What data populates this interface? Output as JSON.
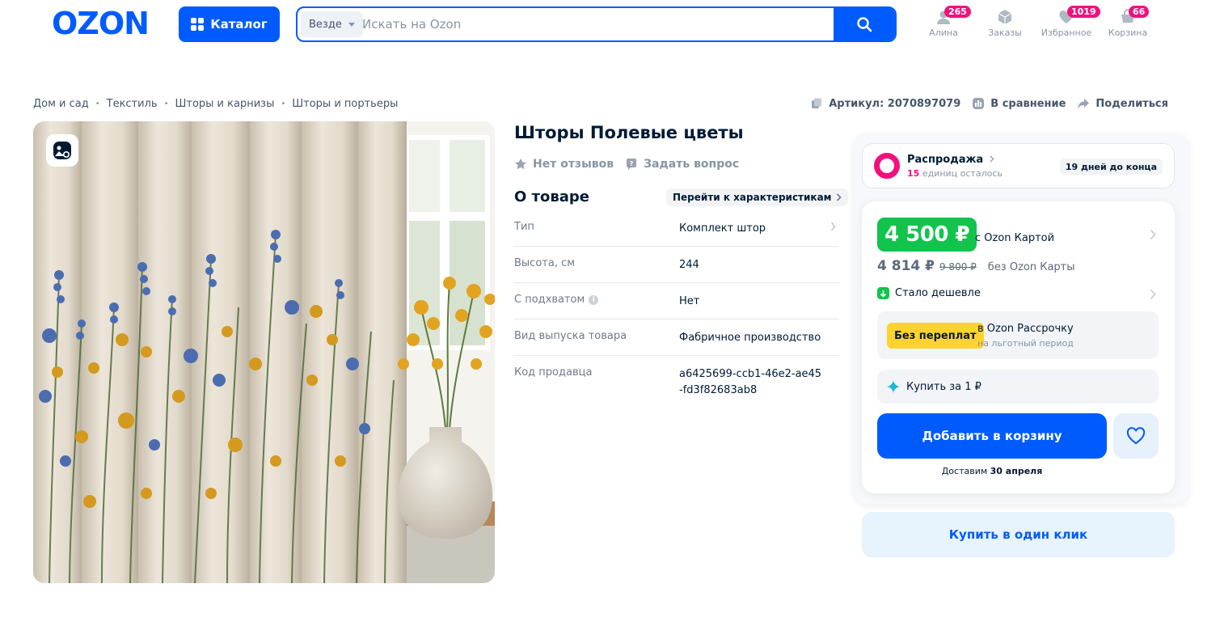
{
  "header": {
    "logo": "OZON",
    "catalog_label": "Каталог",
    "search": {
      "scope": "Везде",
      "placeholder": "Искать на Ozon"
    },
    "items": [
      {
        "label": "Алина",
        "badge": "265",
        "icon": "user-icon"
      },
      {
        "label": "Заказы",
        "badge": "",
        "icon": "box-icon"
      },
      {
        "label": "Избранное",
        "badge": "1019",
        "icon": "heart-icon"
      },
      {
        "label": "Корзина",
        "badge": "66",
        "icon": "cart-icon"
      }
    ]
  },
  "breadcrumbs": [
    "Дом и сад",
    "Текстиль",
    "Шторы и карнизы",
    "Шторы и портьеры"
  ],
  "meta": {
    "article": "Артикул: 2070897079",
    "compare": "В сравнение",
    "share": "Поделиться"
  },
  "product": {
    "title": "Шторы Полевые цветы",
    "reviews": "Нет отзывов",
    "ask": "Задать вопрос",
    "about_title": "О товаре",
    "goto_chars": "Перейти к характеристикам",
    "specs": [
      {
        "key": "Тип",
        "value": "Комплект штор"
      },
      {
        "key": "Высота, см",
        "value": "244"
      },
      {
        "key": "С подхватом",
        "value": "Нет"
      },
      {
        "key": "Вид выпуска товара",
        "value": "Фабричное производство"
      },
      {
        "key": "Код продавца",
        "value": "a6425699-ccb1-46e2-ae45-fd3f82683ab8"
      }
    ]
  },
  "buy": {
    "sale_title": "Распродажа",
    "sale_count": "15",
    "sale_count_suffix": "единиц осталось",
    "sale_days": "19 дней до конца",
    "price_card": "4 500 ₽",
    "price_card_label": "с Ozon Картой",
    "price_noncard": "4 814 ₽",
    "price_old": "9 800 ₽",
    "price_noncard_label": "без Ozon Карты",
    "cheaper": "Стало дешевле",
    "installment_tag": "Без переплат",
    "installment_title": "в Ozon Рассрочку",
    "installment_sub": "на льготный период",
    "buy_for_1": "Купить за 1 ₽",
    "add_to_cart": "Добавить в корзину",
    "delivery_prefix": "Доставим",
    "delivery_date": "30 апреля",
    "one_click": "Купить в один клик"
  },
  "colors": {
    "brand": "#005bff",
    "price_green": "#10c44c",
    "sale_pink": "#f1117e",
    "installment_yellow": "#ffd22e"
  }
}
